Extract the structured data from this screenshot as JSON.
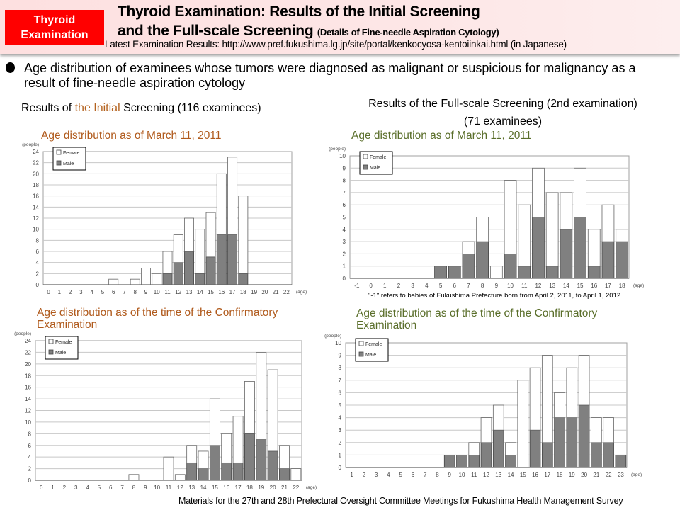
{
  "header": {
    "badge": [
      "Thyroid",
      "Examination"
    ],
    "title_line1": "Thyroid Examination: Results of the Initial Screening",
    "title_line2": "and the Full-scale Screening",
    "title_sub": "(Details of Fine-needle Aspiration Cytology)",
    "latest": "Latest Examination Results: http://www.pref.fukushima.lg.jp/site/portal/kenkocyosa-kentoiinkai.html  (in Japanese)"
  },
  "bullet": "Age distribution of examinees whose tumors were diagnosed as malignant or suspicious for malignancy as a result of fine-needle aspiration cytology",
  "sections": {
    "initial_prefix": "Results of ",
    "initial_highlight": "the Initial",
    "initial_suffix": " Screening (116 examinees)",
    "full_line1": "Results of the Full-scale Screening (2nd examination)",
    "full_line2": "(71 examinees)"
  },
  "footnote": "\"-1\" refers to babies of Fukushima Prefecture born from April 2, 2011, to April 1, 2012",
  "footer": "Materials for the 27th and 28th Prefectural Oversight Committee Meetings for Fukushima Health Management Survey",
  "colors": {
    "male": "#808080",
    "female": "#ffffff",
    "badge": "#ff0000",
    "title_brown": "#b05a1c",
    "title_green": "#5a6e2a"
  },
  "chart_data": [
    {
      "type": "bar",
      "stacked": true,
      "title": "Age distribution as of March 11, 2011",
      "screening": "Initial",
      "ylabel": "(people)",
      "xlabel": "(age)",
      "ylim": [
        0,
        24
      ],
      "yticks": [
        0,
        2,
        4,
        6,
        8,
        10,
        12,
        14,
        16,
        18,
        20,
        22,
        24
      ],
      "grid": true,
      "legend": "top-left",
      "categories": [
        "0",
        "1",
        "2",
        "3",
        "4",
        "5",
        "6",
        "7",
        "8",
        "9",
        "10",
        "11",
        "12",
        "13",
        "14",
        "15",
        "16",
        "17",
        "18",
        "19",
        "20",
        "21",
        "22"
      ],
      "series": [
        {
          "name": "Male",
          "values": [
            0,
            0,
            0,
            0,
            0,
            0,
            0,
            0,
            0,
            0,
            0,
            2,
            4,
            6,
            2,
            5,
            9,
            9,
            2,
            0,
            0,
            0,
            0
          ]
        },
        {
          "name": "Female",
          "values": [
            0,
            0,
            0,
            0,
            0,
            0,
            1,
            0,
            1,
            3,
            2,
            4,
            5,
            6,
            8,
            8,
            11,
            14,
            14,
            0,
            0,
            0,
            0
          ]
        }
      ]
    },
    {
      "type": "bar",
      "stacked": true,
      "title": "Age distribution as of March 11, 2011",
      "screening": "Full-scale",
      "ylabel": "(people)",
      "xlabel": "(age)",
      "ylim": [
        0,
        10
      ],
      "yticks": [
        0,
        1,
        2,
        3,
        4,
        5,
        6,
        7,
        8,
        9,
        10
      ],
      "grid": true,
      "legend": "top-left",
      "categories": [
        "-1",
        "0",
        "1",
        "2",
        "3",
        "4",
        "5",
        "6",
        "7",
        "8",
        "9",
        "10",
        "11",
        "12",
        "13",
        "14",
        "15",
        "16",
        "17",
        "18"
      ],
      "series": [
        {
          "name": "Male",
          "values": [
            0,
            0,
            0,
            0,
            0,
            0,
            1,
            1,
            2,
            3,
            0,
            2,
            1,
            5,
            1,
            4,
            5,
            1,
            3,
            3
          ]
        },
        {
          "name": "Female",
          "values": [
            0,
            0,
            0,
            0,
            0,
            0,
            0,
            0,
            1,
            2,
            1,
            6,
            5,
            4,
            6,
            3,
            4,
            3,
            3,
            1
          ]
        }
      ]
    },
    {
      "type": "bar",
      "stacked": true,
      "title": "Age distribution as of the time of the Confirmatory Examination",
      "screening": "Initial",
      "ylabel": "(people)",
      "xlabel": "(age)",
      "ylim": [
        0,
        24
      ],
      "yticks": [
        0,
        2,
        4,
        6,
        8,
        10,
        12,
        14,
        16,
        18,
        20,
        22,
        24
      ],
      "grid": true,
      "legend": "top-left",
      "categories": [
        "0",
        "1",
        "2",
        "3",
        "4",
        "5",
        "6",
        "7",
        "8",
        "9",
        "10",
        "11",
        "12",
        "13",
        "14",
        "15",
        "16",
        "17",
        "18",
        "19",
        "20",
        "21",
        "22"
      ],
      "series": [
        {
          "name": "Male",
          "values": [
            0,
            0,
            0,
            0,
            0,
            0,
            0,
            0,
            0,
            0,
            0,
            0,
            0,
            3,
            2,
            6,
            3,
            3,
            8,
            7,
            5,
            2,
            0
          ]
        },
        {
          "name": "Female",
          "values": [
            0,
            0,
            0,
            0,
            0,
            0,
            0,
            0,
            1,
            0,
            0,
            4,
            1,
            3,
            3,
            8,
            5,
            8,
            9,
            15,
            14,
            4,
            2
          ]
        }
      ]
    },
    {
      "type": "bar",
      "stacked": true,
      "title": "Age distribution as of the time of the Confirmatory Examination",
      "screening": "Full-scale",
      "ylabel": "(people)",
      "xlabel": "(age)",
      "ylim": [
        0,
        10
      ],
      "yticks": [
        0,
        1,
        2,
        3,
        4,
        5,
        6,
        7,
        8,
        9,
        10
      ],
      "grid": true,
      "legend": "top-left",
      "categories": [
        "1",
        "2",
        "3",
        "4",
        "5",
        "6",
        "7",
        "8",
        "9",
        "10",
        "11",
        "12",
        "13",
        "14",
        "15",
        "16",
        "17",
        "18",
        "19",
        "20",
        "21",
        "22",
        "23"
      ],
      "series": [
        {
          "name": "Male",
          "values": [
            0,
            0,
            0,
            0,
            0,
            0,
            0,
            0,
            1,
            1,
            1,
            2,
            3,
            1,
            0,
            3,
            2,
            4,
            4,
            5,
            2,
            2,
            1
          ]
        },
        {
          "name": "Female",
          "values": [
            0,
            0,
            0,
            0,
            0,
            0,
            0,
            0,
            0,
            0,
            1,
            2,
            2,
            1,
            7,
            5,
            7,
            2,
            4,
            4,
            2,
            2,
            0
          ]
        }
      ]
    }
  ]
}
